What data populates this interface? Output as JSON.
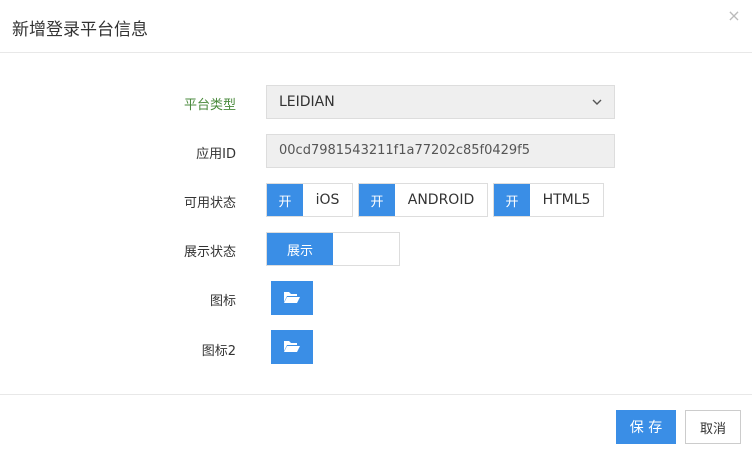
{
  "dialog": {
    "title": "新增登录平台信息",
    "close_symbol": "×"
  },
  "form": {
    "platform_type": {
      "label": "平台类型",
      "value": "LEIDIAN"
    },
    "app_id": {
      "label": "应用ID",
      "value": "00cd7981543211f1a77202c85f0429f5"
    },
    "availability": {
      "label": "可用状态",
      "toggles": [
        {
          "state": "开",
          "name": "iOS"
        },
        {
          "state": "开",
          "name": "ANDROID"
        },
        {
          "state": "开",
          "name": "HTML5"
        }
      ]
    },
    "display_status": {
      "label": "展示状态",
      "value": "展示"
    },
    "icon": {
      "label": "图标"
    },
    "icon2": {
      "label": "图标2"
    }
  },
  "footer": {
    "save_label": "保 存",
    "cancel_label": "取消"
  },
  "colors": {
    "primary": "#3a8ee6",
    "label_green": "#4a8a3c",
    "readonly_bg": "#efefef"
  },
  "icons": [
    "close-icon",
    "chevron-down-icon",
    "folder-open-icon"
  ]
}
